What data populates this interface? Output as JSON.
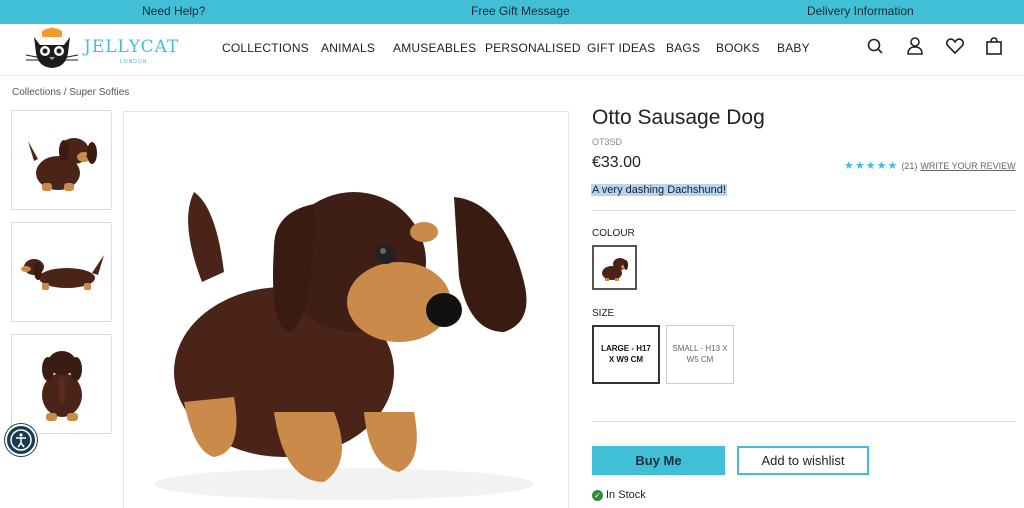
{
  "topbar": {
    "help": "Need Help?",
    "gift": "Free Gift Message",
    "delivery": "Delivery Information"
  },
  "brand": {
    "name": "JELLYCAT",
    "sub": "LONDON",
    "accent": "#41bfd6"
  },
  "nav": [
    "COLLECTIONS",
    "ANIMALS",
    "AMUSEABLES",
    "PERSONALISED",
    "GIFT IDEAS",
    "BAGS",
    "BOOKS",
    "BABY"
  ],
  "header_icons": [
    "search-icon",
    "account-icon",
    "heart-icon",
    "bag-icon"
  ],
  "breadcrumb": "Collections / Super Softies",
  "product": {
    "title": "Otto Sausage Dog",
    "sku": "OT3SD",
    "price": "€33.00",
    "rating_stars": 5,
    "review_count": "(21)",
    "review_link": "WRITE YOUR REVIEW",
    "tagline": "A very dashing Dachshund!",
    "colour_label": "COLOUR",
    "size_label": "SIZE",
    "sizes": [
      "LARGE - H17 X W9 CM",
      "SMALL - H13 X W5 CM"
    ],
    "selected_size": "LARGE - H17 X W9 CM",
    "buy_label": "Buy Me",
    "wishlist_label": "Add to wishlist",
    "stock": "In Stock"
  }
}
